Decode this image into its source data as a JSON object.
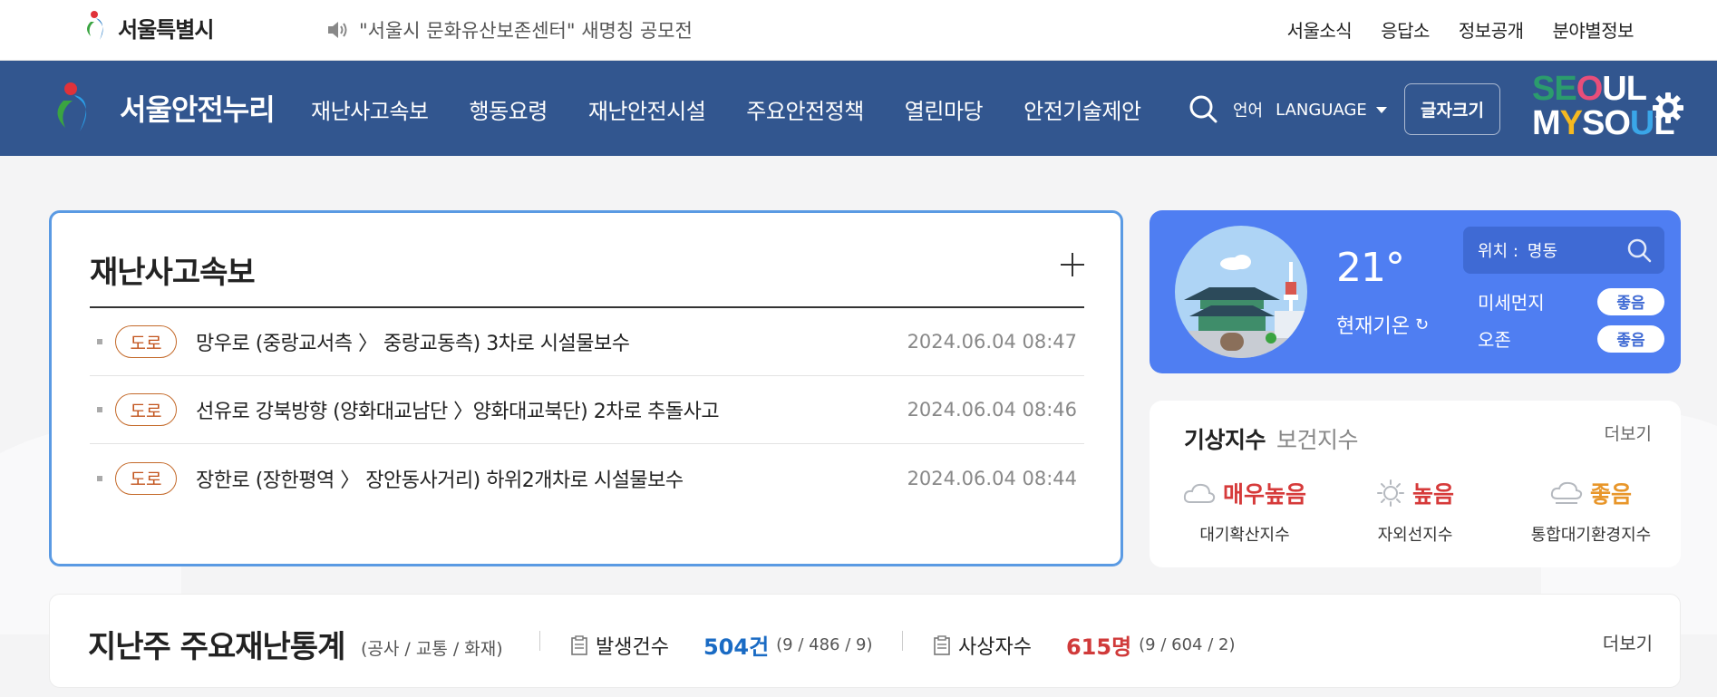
{
  "topbar": {
    "logo_text": "서울특별시",
    "notice": "\"서울시 문화유산보존센터\" 새명칭 공모전",
    "menu": [
      "서울소식",
      "응답소",
      "정보공개",
      "분야별정보"
    ]
  },
  "navbar": {
    "brand": "서울안전누리",
    "menu": [
      "재난사고속보",
      "행동요령",
      "재난안전시설",
      "주요안전정책",
      "열린마당",
      "안전기술제안"
    ],
    "lang_ko": "언어",
    "lang_en": "LANGUAGE",
    "fontsize": "글자크기",
    "slogan_row1": [
      "SE",
      "O",
      "UL"
    ],
    "slogan_row2": [
      "M",
      "Y",
      "SO",
      "U",
      "L"
    ]
  },
  "news": {
    "title": "재난사고속보",
    "items": [
      {
        "tag": "도로",
        "text": "망우로 (중랑교서측  〉 중랑교동측) 3차로 시설물보수",
        "date": "2024.06.04 08:47"
      },
      {
        "tag": "도로",
        "text": "선유로 강북방향 (양화대교남단 〉양화대교북단) 2차로 추돌사고",
        "date": "2024.06.04 08:46"
      },
      {
        "tag": "도로",
        "text": "장한로 (장한평역  〉 장안동사거리) 하위2개차로 시설물보수",
        "date": "2024.06.04 08:44"
      }
    ]
  },
  "weather": {
    "temp": "21°",
    "current_label": "현재기온",
    "location_label": "위치 :",
    "location": "명동",
    "fine_dust_label": "미세먼지",
    "fine_dust_value": "좋음",
    "ozone_label": "오존",
    "ozone_value": "좋음"
  },
  "index": {
    "tab_active": "기상지수",
    "tab_inactive": "보건지수",
    "more": "더보기",
    "items": [
      {
        "value": "매우높음",
        "label": "대기확산지수",
        "color": "#d63a3a",
        "icon": "cloud-icon"
      },
      {
        "value": "높음",
        "label": "자외선지수",
        "color": "#d63a3a",
        "icon": "sun-icon"
      },
      {
        "value": "좋음",
        "label": "통합대기환경지수",
        "color": "#e8962a",
        "icon": "cloud-icon"
      }
    ]
  },
  "stats": {
    "title": "지난주 주요재난통계",
    "sub": "(공사 / 교통 / 화재)",
    "occur_label": "발생건수",
    "occur_value": "504건",
    "occur_break": "(9 / 486 / 9)",
    "casualty_label": "사상자수",
    "casualty_value": "615명",
    "casualty_break": "(9 / 604 / 2)",
    "more": "더보기"
  },
  "colors": {
    "nav_bg": "#32568f",
    "card_border": "#5a9ae3",
    "weather_bg": "#4f7ef2",
    "tag": "#c2541d"
  }
}
